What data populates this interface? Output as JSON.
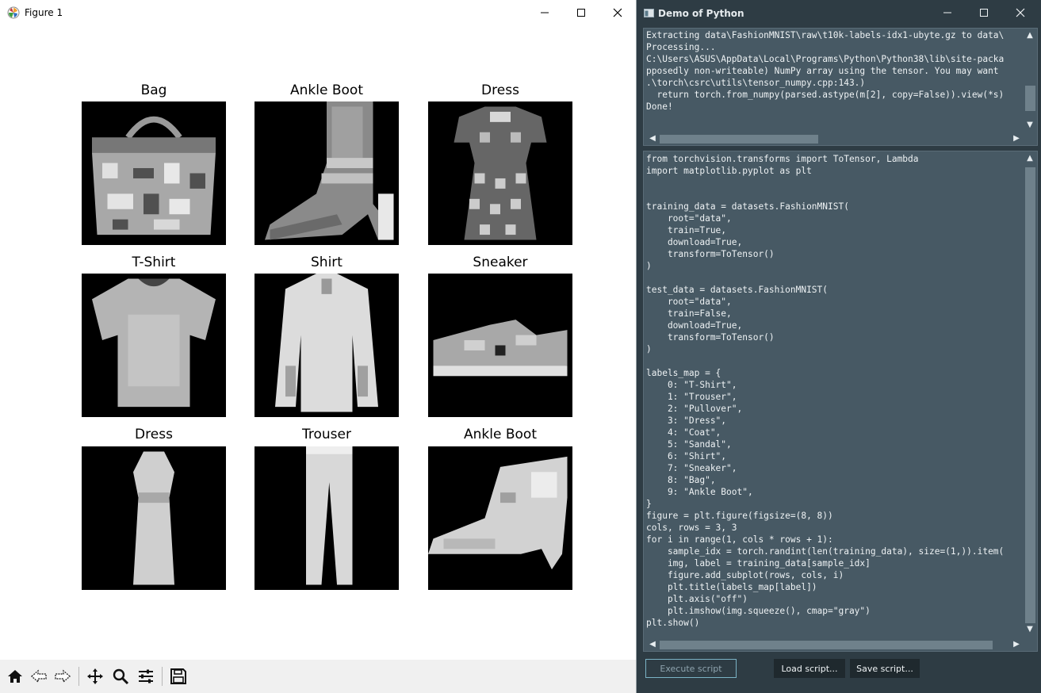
{
  "figure_window": {
    "title": "Figure 1",
    "subplots": [
      {
        "label": "Bag"
      },
      {
        "label": "Ankle Boot"
      },
      {
        "label": "Dress"
      },
      {
        "label": "T-Shirt"
      },
      {
        "label": "Shirt"
      },
      {
        "label": "Sneaker"
      },
      {
        "label": "Dress"
      },
      {
        "label": "Trouser"
      },
      {
        "label": "Ankle Boot"
      }
    ],
    "toolbar_icons": [
      "home-icon",
      "back-arrow-icon",
      "forward-arrow-icon",
      "pan-icon",
      "zoom-icon",
      "configure-subplots-icon",
      "save-icon"
    ]
  },
  "python_window": {
    "title": "Demo of Python",
    "output_text": "Extracting data\\FashionMNIST\\raw\\t10k-labels-idx1-ubyte.gz to data\\\nProcessing...\nC:\\Users\\ASUS\\AppData\\Local\\Programs\\Python\\Python38\\lib\\site-packa\npposedly non-writeable) NumPy array using the tensor. You may want\n.\\torch\\csrc\\utils\\tensor_numpy.cpp:143.)\n  return torch.from_numpy(parsed.astype(m[2], copy=False)).view(*s)\nDone!",
    "code_text": "from torchvision.transforms import ToTensor, Lambda\nimport matplotlib.pyplot as plt\n\n\ntraining_data = datasets.FashionMNIST(\n    root=\"data\",\n    train=True,\n    download=True,\n    transform=ToTensor()\n)\n\ntest_data = datasets.FashionMNIST(\n    root=\"data\",\n    train=False,\n    download=True,\n    transform=ToTensor()\n)\n\nlabels_map = {\n    0: \"T-Shirt\",\n    1: \"Trouser\",\n    2: \"Pullover\",\n    3: \"Dress\",\n    4: \"Coat\",\n    5: \"Sandal\",\n    6: \"Shirt\",\n    7: \"Sneaker\",\n    8: \"Bag\",\n    9: \"Ankle Boot\",\n}\nfigure = plt.figure(figsize=(8, 8))\ncols, rows = 3, 3\nfor i in range(1, cols * rows + 1):\n    sample_idx = torch.randint(len(training_data), size=(1,)).item(\n    img, label = training_data[sample_idx]\n    figure.add_subplot(rows, cols, i)\n    plt.title(labels_map[label])\n    plt.axis(\"off\")\n    plt.imshow(img.squeeze(), cmap=\"gray\")\nplt.show()",
    "buttons": {
      "execute": "Execute script",
      "load": "Load script...",
      "save": "Save script..."
    },
    "colors": {
      "window_bg": "#2e3c44",
      "panel_bg": "#475964",
      "text": "#eef2f4",
      "execute_border": "#7bb3c5"
    }
  }
}
